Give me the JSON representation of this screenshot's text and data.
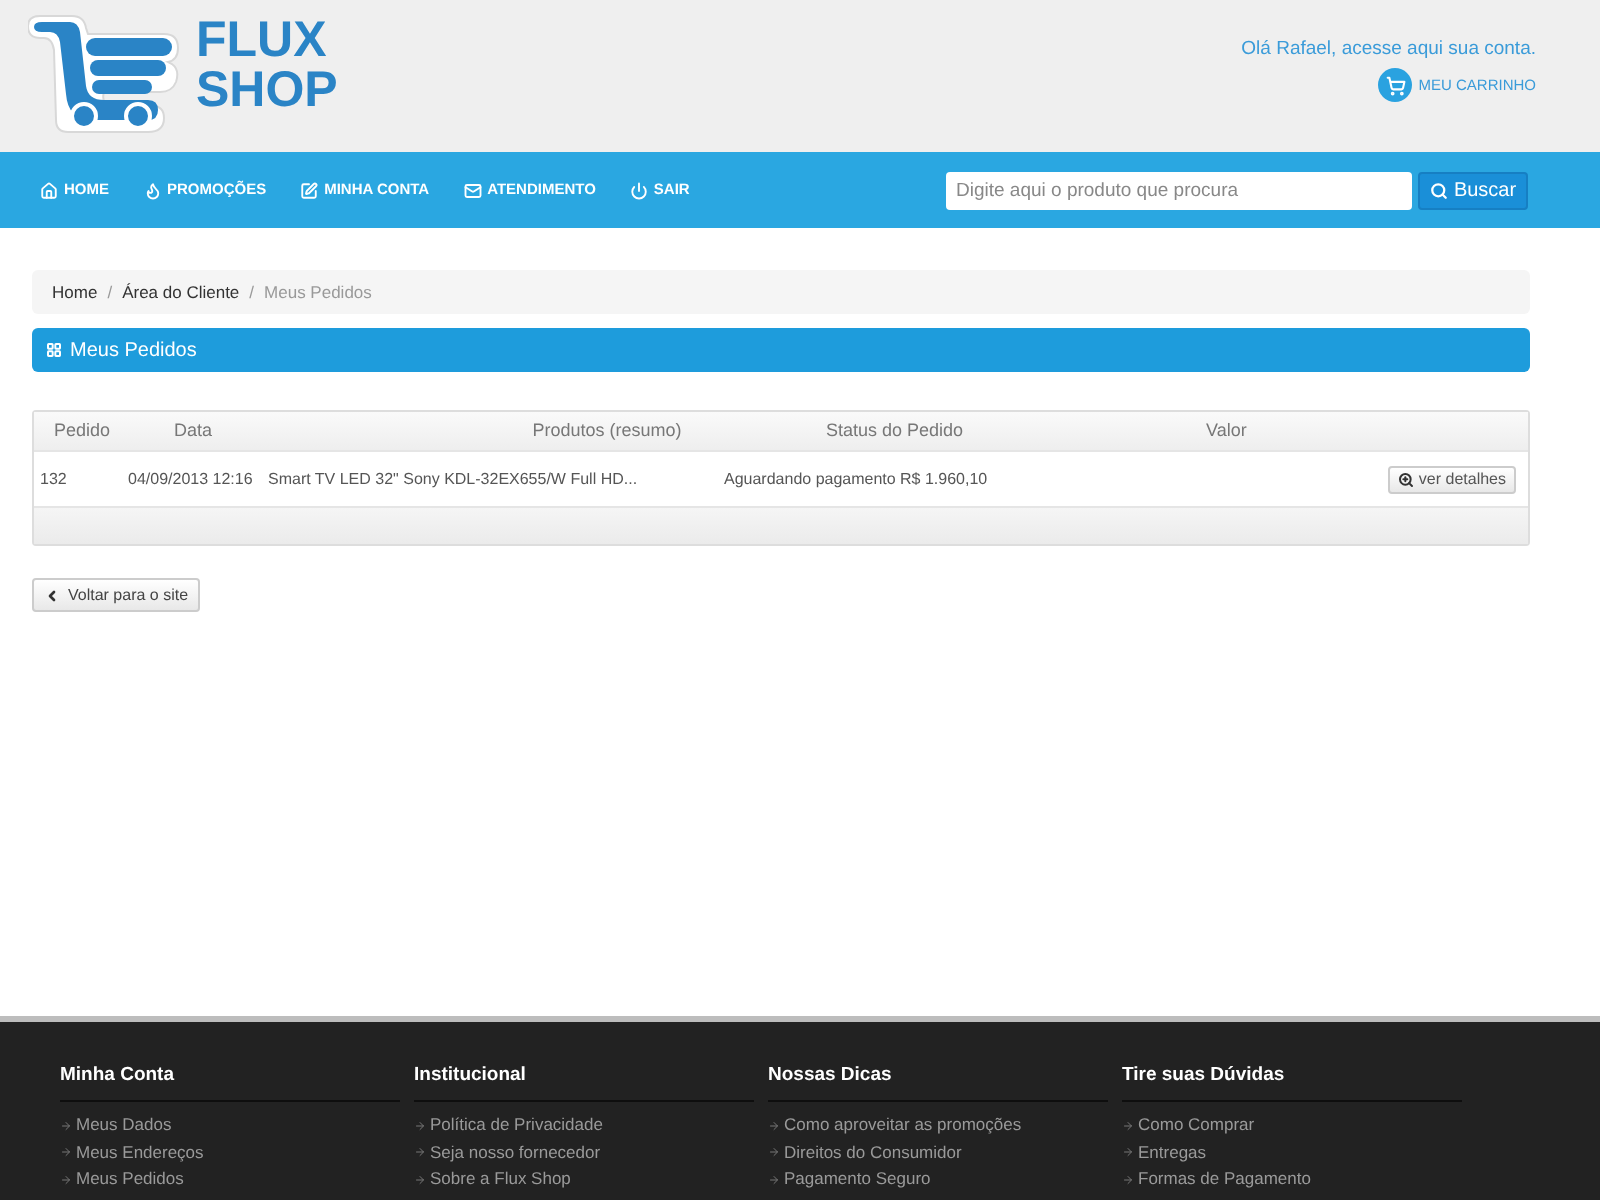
{
  "header": {
    "logo": "FLUX SHOP",
    "greeting": "Olá Rafael, acesse aqui sua conta.",
    "cart_link": "MEU CARRINHO"
  },
  "nav": {
    "items": [
      "HOME",
      "PROMOÇÕES",
      "MINHA CONTA",
      "ATENDIMENTO",
      "SAIR"
    ],
    "search": {
      "placeholder": "Digite aqui o produto que procura",
      "button": "Buscar"
    }
  },
  "breadcrumb": {
    "separator": "/",
    "items": [
      {
        "label": "Home",
        "current": false
      },
      {
        "label": "Área do Cliente",
        "current": false
      },
      {
        "label": "Meus Pedidos",
        "current": true
      }
    ]
  },
  "panel_title": "Meus Pedidos",
  "table": {
    "columns": [
      "Pedido",
      "Data",
      "Produtos (resumo)",
      "Status do Pedido",
      "Valor"
    ],
    "rows": [
      {
        "pedido": "132",
        "data": "04/09/2013 12:16",
        "produtos": "Smart TV LED 32\" Sony KDL-32EX655/W Full HD...",
        "status": "Aguardando pagamento",
        "valor": "R$ 1.960,10",
        "action": "ver detalhes"
      }
    ]
  },
  "back_button": "Voltar para o site",
  "footer": {
    "columns": [
      {
        "title": "Minha Conta",
        "links": [
          "Meus Dados",
          "Meus Endereços",
          "Meus Pedidos"
        ]
      },
      {
        "title": "Institucional",
        "links": [
          "Política de Privacidade",
          "Seja nosso fornecedor",
          "Sobre a Flux Shop"
        ]
      },
      {
        "title": "Nossas Dicas",
        "links": [
          "Como aproveitar as promoções",
          "Direitos do Consumidor",
          "Pagamento Seguro"
        ]
      },
      {
        "title": "Tire suas Dúvidas",
        "links": [
          "Como Comprar",
          "Entregas",
          "Formas de Pagamento"
        ]
      }
    ]
  }
}
